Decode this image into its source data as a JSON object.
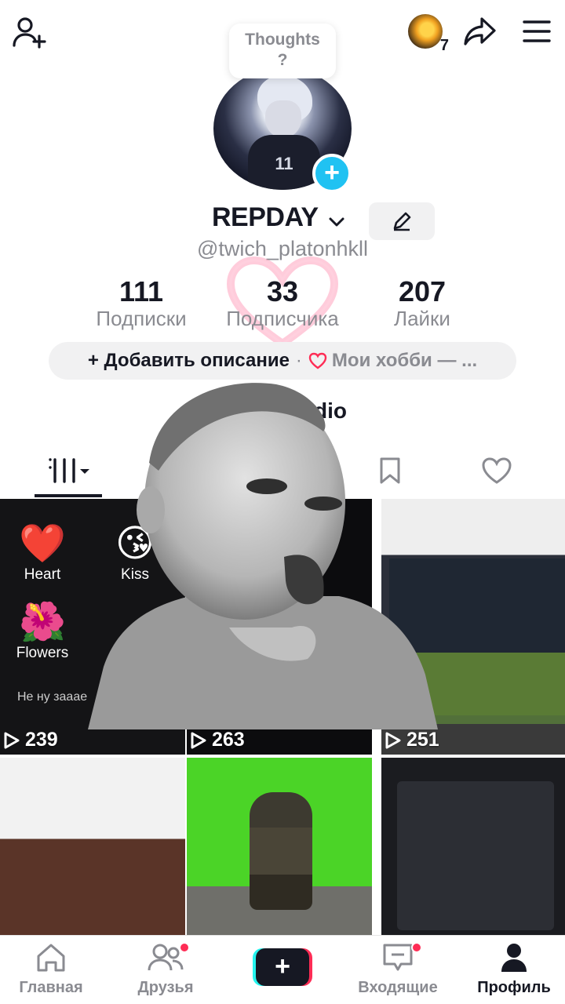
{
  "topbar": {
    "icons": [
      "add-friend-icon",
      "coin-icon",
      "share-icon",
      "menu-icon"
    ],
    "coin_count": "7"
  },
  "thoughts": {
    "line1": "Thoughts",
    "line2": "?"
  },
  "avatar": {
    "jersey_number": "11"
  },
  "profile": {
    "name": "REPDAY",
    "handle": "@twich_platonhkll"
  },
  "stats": [
    {
      "value": "111",
      "label": "Подписки"
    },
    {
      "value": "33",
      "label": "Подписчика"
    },
    {
      "value": "207",
      "label": "Лайки"
    }
  ],
  "bio": {
    "add_label": "+ Добавить описание",
    "separator": "·",
    "hobby_label": "Мои хобби — ..."
  },
  "studio_fragment": "dio",
  "tabs": [
    "grid-icon",
    "bookmark-icon",
    "heart-icon"
  ],
  "grid": [
    {
      "views": "239",
      "emojis": [
        {
          "glyph": "❤️",
          "label": "Heart"
        },
        {
          "glyph": "😘",
          "label": "Kiss"
        },
        {
          "glyph": "🌺",
          "label": "Flowers"
        }
      ],
      "caption": "Не ну зааае"
    },
    {
      "views": "263"
    },
    {
      "views": "251"
    },
    {
      "views": ""
    },
    {
      "views": ""
    },
    {
      "views": ""
    }
  ],
  "bottom_nav": [
    {
      "label": "Главная",
      "icon": "home-icon",
      "dot": false
    },
    {
      "label": "Друзья",
      "icon": "friends-icon",
      "dot": true
    },
    {
      "label": "",
      "icon": "create-icon",
      "dot": false
    },
    {
      "label": "Входящие",
      "icon": "inbox-icon",
      "dot": true
    },
    {
      "label": "Профиль",
      "icon": "profile-icon",
      "dot": false
    }
  ],
  "colors": {
    "accent_blue": "#20c2f2",
    "brand_red": "#fe2c55",
    "brand_cyan": "#25f4ee",
    "text_primary": "#161823",
    "text_secondary": "#8a8b91"
  }
}
